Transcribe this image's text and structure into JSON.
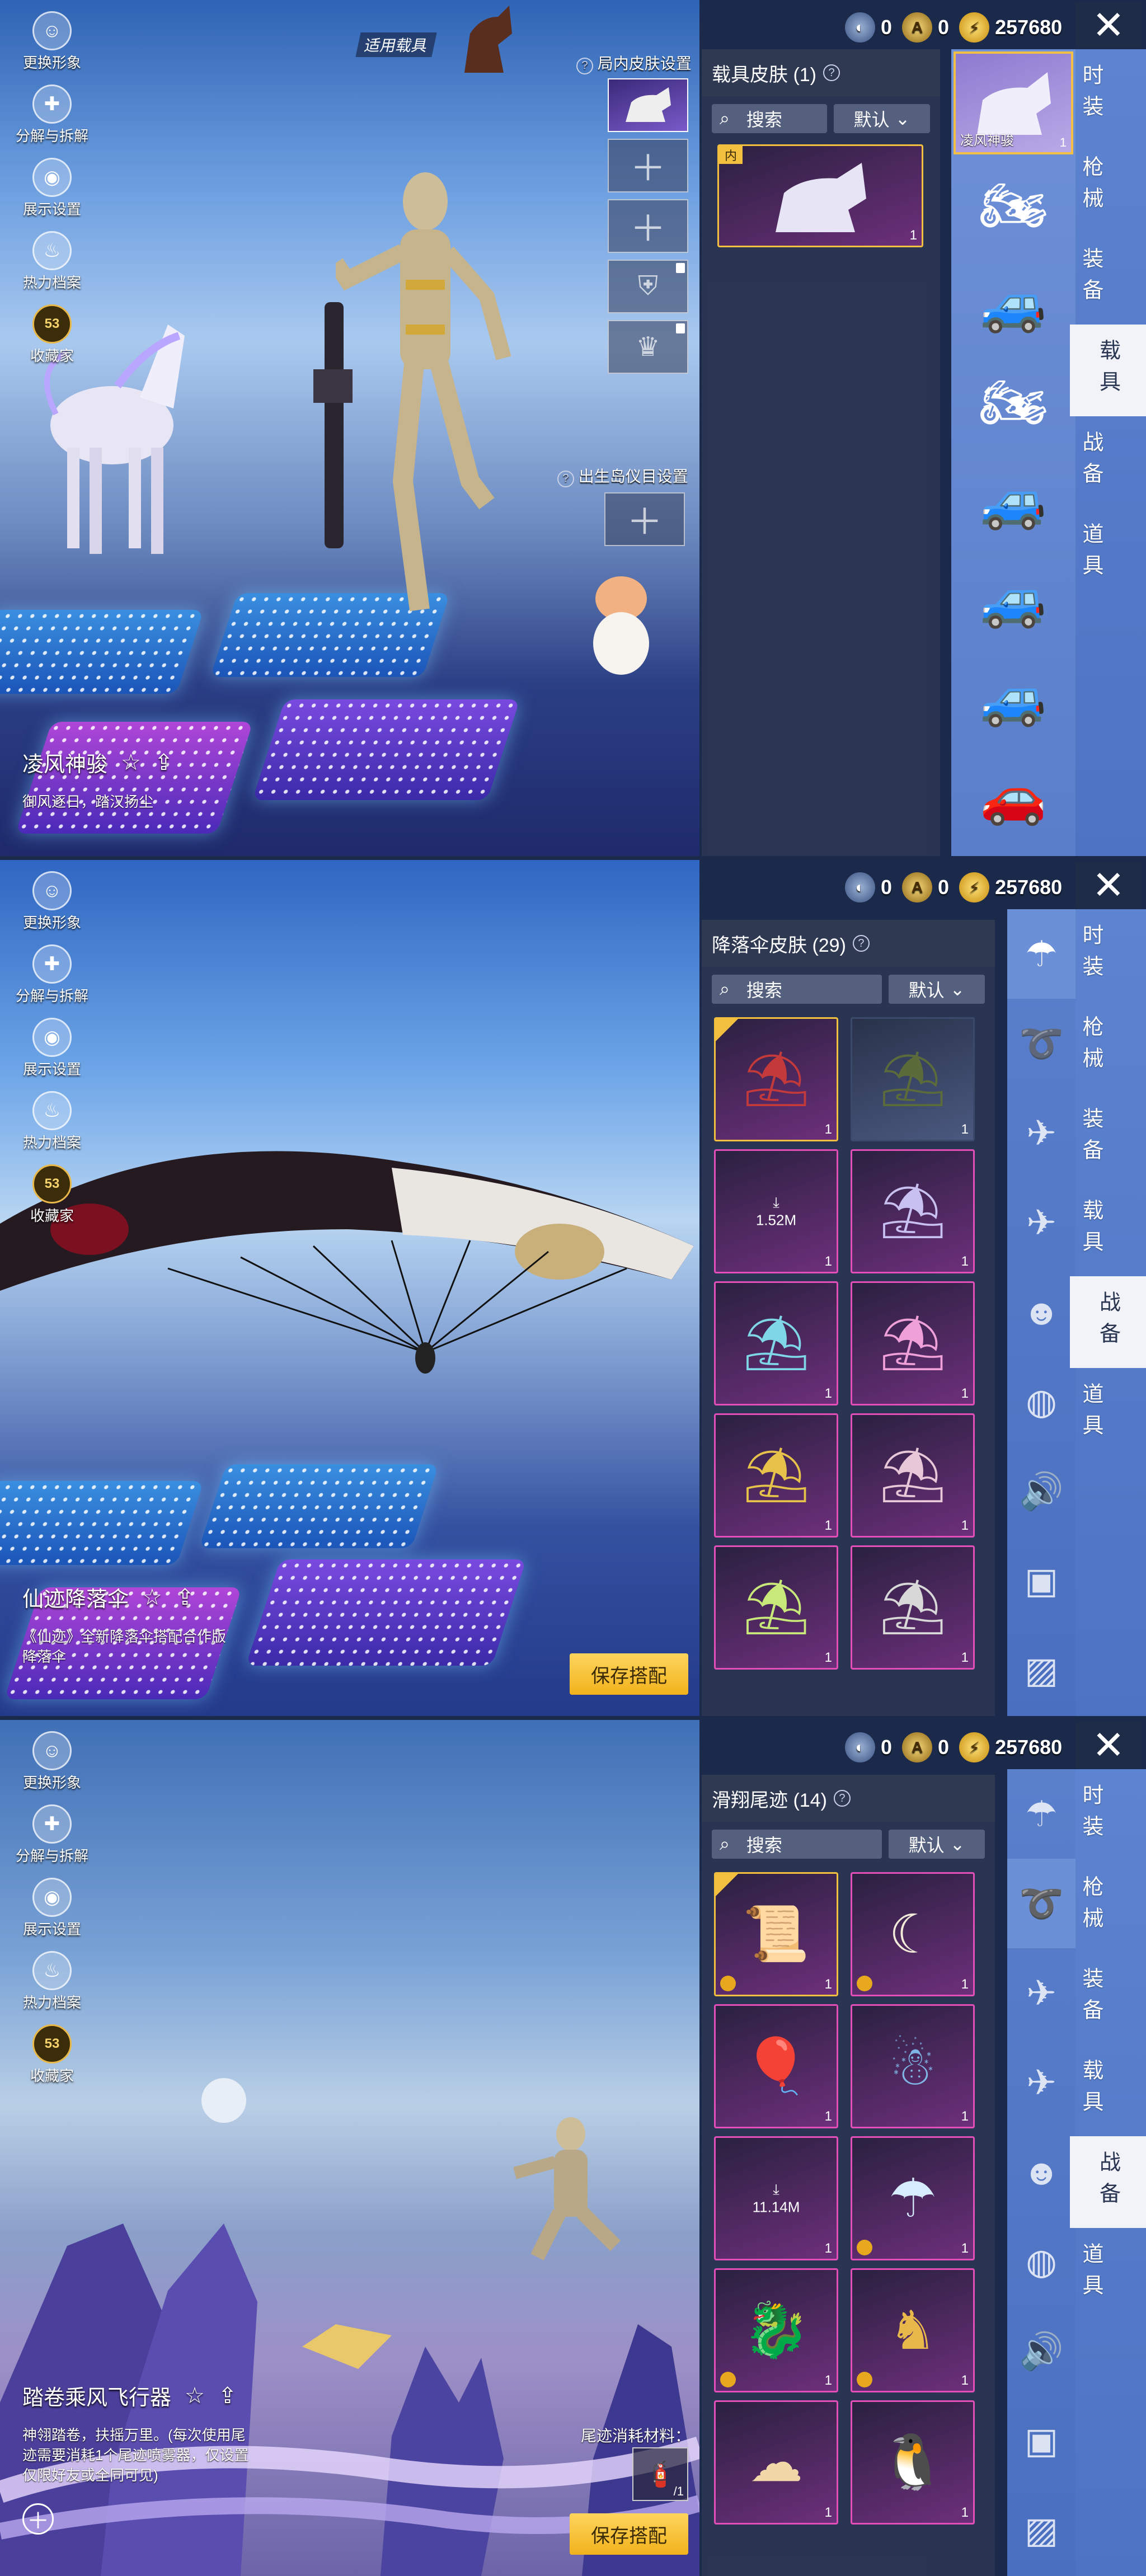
{
  "left_menu": [
    {
      "label": "更换形象",
      "icon": "avatar-icon"
    },
    {
      "label": "分解与拆解",
      "icon": "disassemble-icon"
    },
    {
      "label": "展示设置",
      "icon": "eye-icon"
    },
    {
      "label": "热力档案",
      "icon": "flame-icon"
    },
    {
      "label": "收藏家",
      "icon": "collector-badge-icon",
      "badge_text": "53"
    }
  ],
  "currency": {
    "bp": "0",
    "ag": "0",
    "uc": "257680"
  },
  "categories": [
    "时装",
    "枪械",
    "装备",
    "载具",
    "战备",
    "道具"
  ],
  "screen1": {
    "active_category": "载具",
    "vehicle_label": "适用载具",
    "slot_title": "局内皮肤设置",
    "spawn_title": "出生岛仪目设置",
    "panel_title": "载具皮肤 (1)",
    "search": "搜索",
    "sort": "默认",
    "card_tag": "内",
    "card_qty": "1",
    "item_name": "凌风神骏",
    "item_desc": "御风逐日，踏汉扬尘",
    "vehicles": [
      {
        "name": "凌风神骏",
        "count": "1"
      },
      {
        "name": "",
        "count": ""
      },
      {
        "name": "",
        "count": ""
      },
      {
        "name": "",
        "count": ""
      },
      {
        "name": "",
        "count": ""
      },
      {
        "name": "",
        "count": ""
      },
      {
        "name": "",
        "count": ""
      }
    ]
  },
  "screen2": {
    "active_category": "战备",
    "panel_title": "降落伞皮肤 (29)",
    "search": "搜索",
    "sort": "默认",
    "download_size": "1.52M",
    "item_name": "仙迹降落伞",
    "item_desc": "《仙迹》全新降落伞搭配合作版降落伞",
    "save": "保存搭配",
    "cards_qty": [
      "1",
      "1",
      "1",
      "1",
      "1",
      "1",
      "1",
      "1",
      "1",
      "1"
    ]
  },
  "screen3": {
    "active_category": "战备",
    "panel_title": "滑翔尾迹 (14)",
    "search": "搜索",
    "sort": "默认",
    "download_size": "11.14M",
    "item_name": "踏卷乘风飞行器",
    "item_desc": "神翎踏卷，扶摇万里。(每次使用尾迹需要消耗1个尾迹喷雾器，仅设置仅限好友或全同可见)",
    "material_label": "尾迹消耗材料：",
    "material_count": "/1",
    "save": "保存搭配",
    "cards_qty": [
      "1",
      "1",
      "1",
      "1",
      "1",
      "1",
      "1",
      "1",
      "1",
      "1"
    ]
  }
}
